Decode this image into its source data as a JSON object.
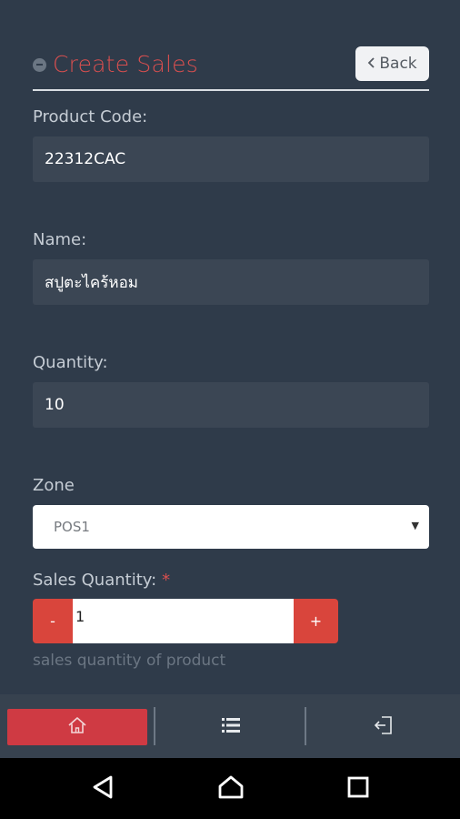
{
  "header": {
    "title": "Create Sales",
    "back_label": "Back"
  },
  "form": {
    "product_code": {
      "label": "Product Code:",
      "value": "22312CAC"
    },
    "name": {
      "label": "Name:",
      "value": "สปูตะไคร้หอม"
    },
    "quantity": {
      "label": "Quantity:",
      "value": "10"
    },
    "zone": {
      "label": "Zone",
      "selected": "POS1"
    },
    "sales_quantity": {
      "label": "Sales Quantity:",
      "required_mark": "*",
      "minus_label": "-",
      "plus_label": "+",
      "value": "1",
      "help": "sales quantity of product"
    }
  },
  "bottom_nav": {
    "items": [
      {
        "icon": "home-icon",
        "active": true
      },
      {
        "icon": "list-icon",
        "active": false
      },
      {
        "icon": "logout-icon",
        "active": false
      }
    ],
    "active_color": "#cf3a43"
  },
  "system_nav": {
    "items": [
      "back-icon",
      "home-icon",
      "recents-icon"
    ]
  },
  "colors": {
    "background": "#2f3b4a",
    "accent": "#d94f4f",
    "field_bg": "#3b4654"
  }
}
